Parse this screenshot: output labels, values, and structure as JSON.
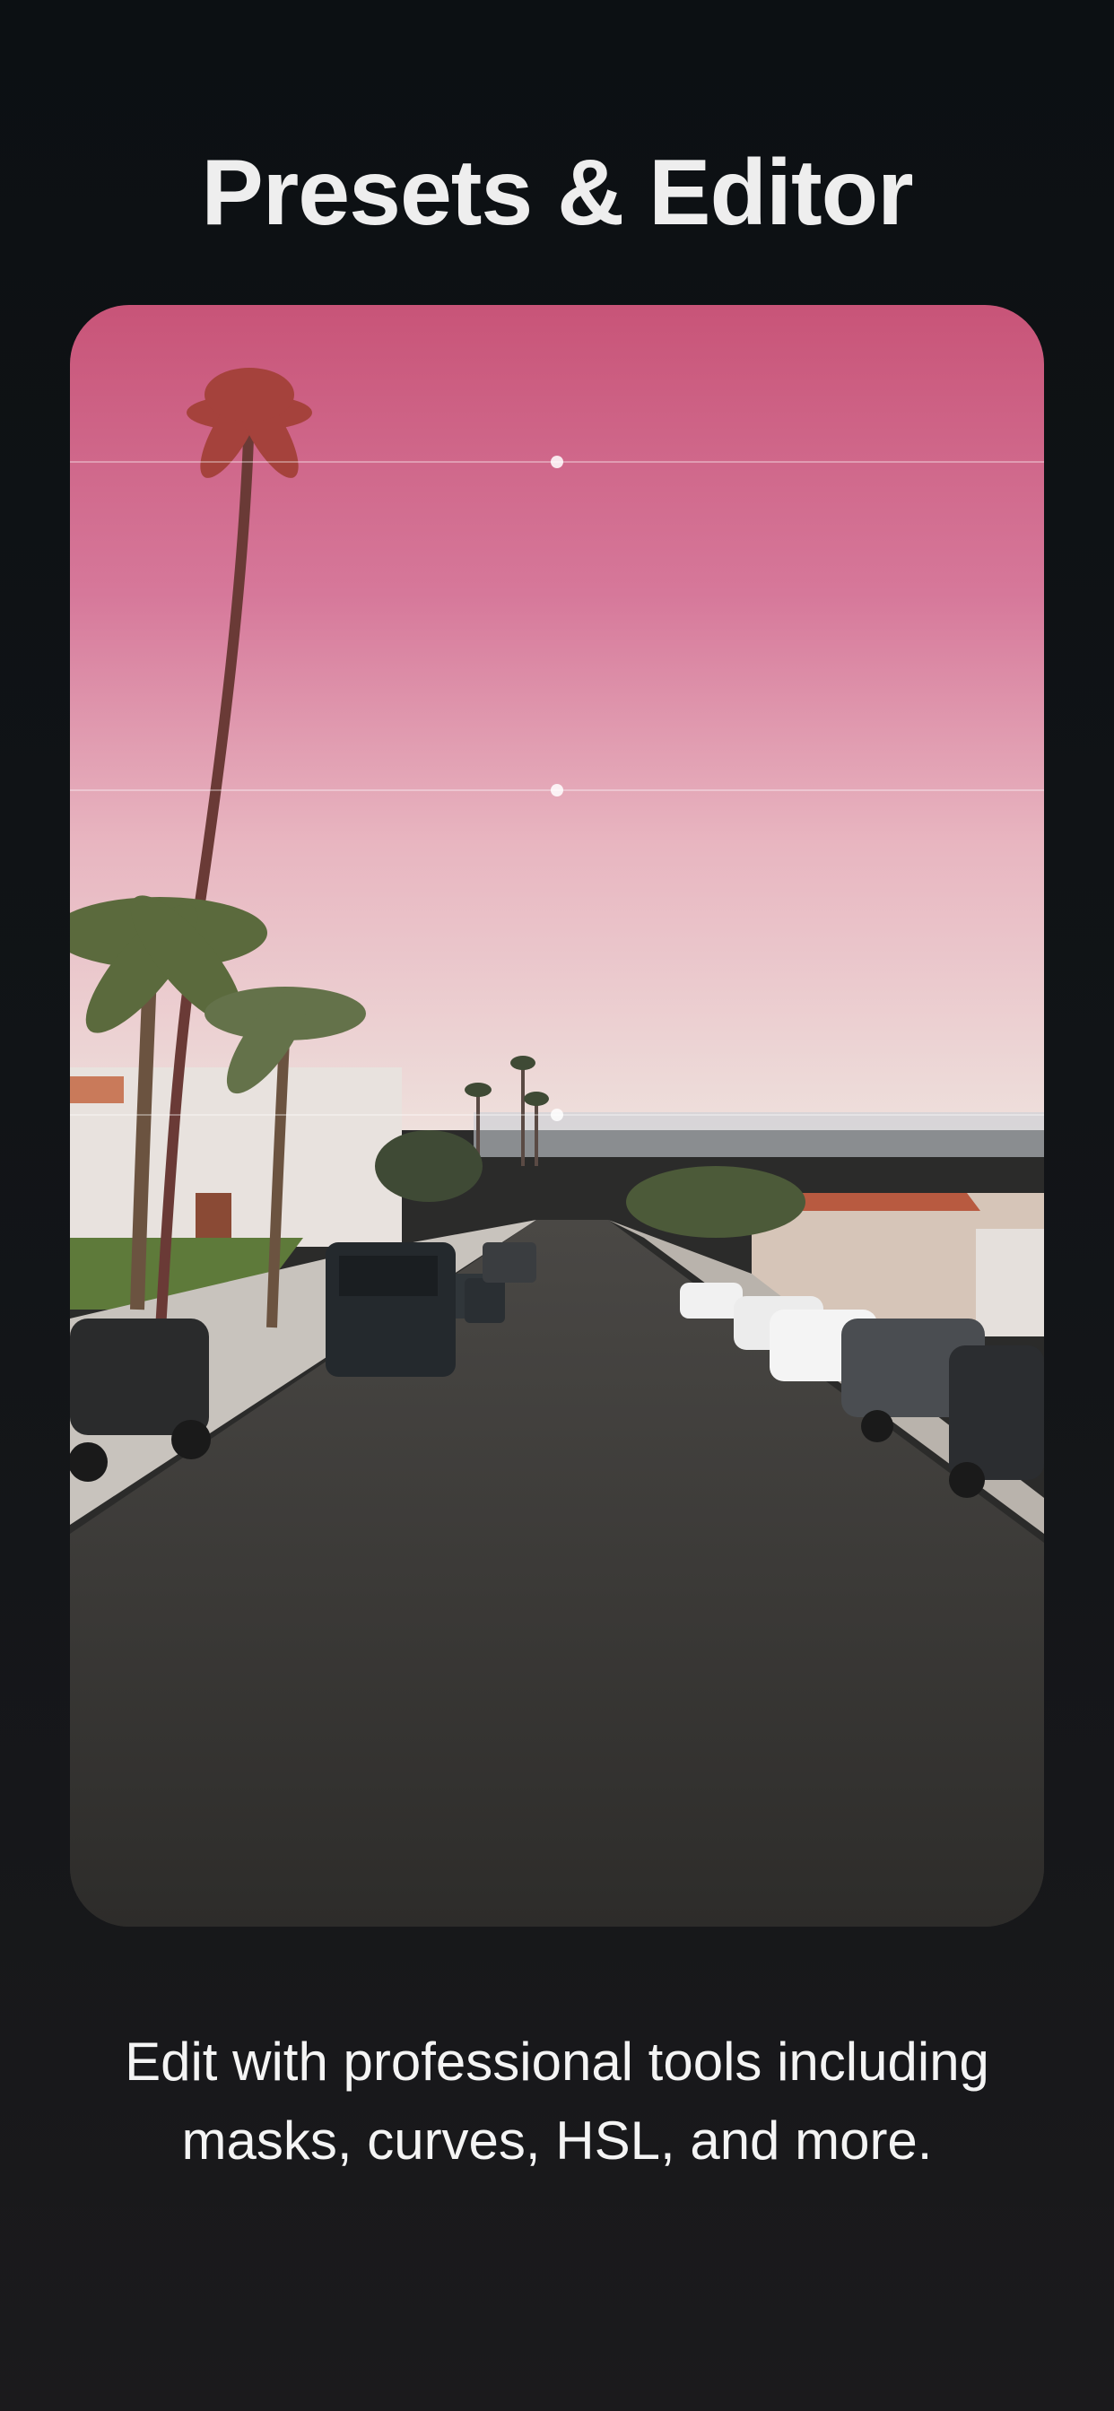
{
  "page": {
    "title": "Presets & Editor",
    "caption": "Edit with professional tools including masks, curves, HSL, and more."
  },
  "photo": {
    "subject": "street-with-palm-trees-pink-sky",
    "sky_top_color": "#c85478",
    "sky_horizon_color": "#efd9d6",
    "road_color": "#3d3b37"
  },
  "mask_guides": {
    "handle_icon": "dot-handle-icon",
    "count": 3
  }
}
